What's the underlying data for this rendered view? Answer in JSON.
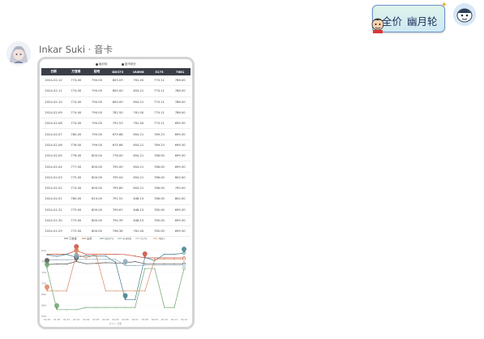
{
  "chip": {
    "part1": "全价",
    "part2": "幽月轮"
  },
  "message": {
    "sender": "Inkar Suki · 音卡"
  },
  "card": {
    "legend_top": [
      "幽月轮",
      "蓝市统计"
    ],
    "table": {
      "headers": [
        "日期",
        "万宝楼",
        "贴吧",
        "DD373",
        "UU898",
        "5173",
        "7881"
      ],
      "rows": [
        [
          "2024-02-12",
          "774.00",
          "790.00",
          "803.03",
          "761.00",
          "770.11",
          "786.00"
        ],
        [
          "2024-02-11",
          "774.00",
          "790.00",
          "800.00",
          "654.21",
          "770.11",
          "786.00"
        ],
        [
          "2024-02-10",
          "774.00",
          "790.00",
          "800.00",
          "654.21",
          "770.11",
          "786.00"
        ],
        [
          "2024-02-09",
          "774.00",
          "790.00",
          "782.50",
          "761.00",
          "770.11",
          "786.00"
        ],
        [
          "2024-02-08",
          "774.00",
          "790.00",
          "791.53",
          "761.00",
          "770.11",
          "699.30"
        ],
        [
          "2024-02-07",
          "780.00",
          "795.00",
          "675.68",
          "654.21",
          "769.23",
          "699.30"
        ],
        [
          "2024-02-06",
          "776.00",
          "799.00",
          "675.68",
          "654.21",
          "769.23",
          "699.30"
        ],
        [
          "2024-02-05",
          "776.00",
          "800.00",
          "778.00",
          "654.21",
          "786.00",
          "699.30"
        ],
        [
          "2024-02-04",
          "777.00",
          "800.00",
          "795.00",
          "654.21",
          "786.00",
          "699.30"
        ],
        [
          "2024-02-03",
          "775.00",
          "800.00",
          "795.04",
          "654.21",
          "786.00",
          "800.00"
        ],
        [
          "2024-02-02",
          "774.00",
          "800.00",
          "795.80",
          "654.21",
          "786.00",
          "790.00"
        ],
        [
          "2024-02-01",
          "780.00",
          "810.00",
          "791.51",
          "648.15",
          "786.00",
          "800.00"
        ],
        [
          "2024-01-31",
          "773.00",
          "800.00",
          "799.67",
          "648.15",
          "785.00",
          "699.30"
        ],
        [
          "2024-01-30",
          "773.00",
          "800.00",
          "794.39",
          "648.15",
          "785.00",
          "699.30"
        ],
        [
          "2024-01-29",
          "772.00",
          "800.00",
          "798.36",
          "761.00",
          "785.00",
          "699.30"
        ]
      ]
    }
  },
  "chart_data": {
    "type": "line",
    "x": [
      "01-29",
      "01-30",
      "01-31",
      "02-01",
      "02-02",
      "02-03",
      "02-04",
      "02-05",
      "02-06",
      "02-07",
      "02-08",
      "02-09",
      "02-10",
      "02-11",
      "02-12"
    ],
    "ylim": [
      630,
      810
    ],
    "yticks": [
      810,
      780,
      750,
      720,
      690,
      660,
      630
    ],
    "xlabel": "Price / 日期",
    "series": [
      {
        "name": "万宝楼",
        "color": "#555555",
        "values": [
          772,
          773,
          773,
          780,
          774,
          775,
          777,
          776,
          776,
          780,
          774,
          774,
          774,
          774,
          774
        ]
      },
      {
        "name": "贴吧",
        "color": "#c84a3a",
        "values": [
          800,
          800,
          800,
          810,
          800,
          800,
          800,
          800,
          799,
          795,
          790,
          790,
          790,
          790,
          790
        ]
      },
      {
        "name": "DD373",
        "color": "#3e7c8c",
        "values": [
          798.36,
          794.39,
          799.67,
          791.51,
          795.8,
          795.04,
          795,
          778,
          675.68,
          675.68,
          791.53,
          782.5,
          800,
          800,
          803.03
        ]
      },
      {
        "name": "UU898",
        "color": "#6ba36f",
        "values": [
          761,
          648.15,
          648.15,
          648.15,
          654.21,
          654.21,
          654.21,
          654.21,
          654.21,
          654.21,
          761,
          761,
          654.21,
          654.21,
          761
        ]
      },
      {
        "name": "5173",
        "color": "#8aa8b8",
        "values": [
          785,
          785,
          785,
          786,
          786,
          786,
          786,
          786,
          769.23,
          769.23,
          770.11,
          770.11,
          770.11,
          770.11,
          770.11
        ]
      },
      {
        "name": "7881",
        "color": "#d9835a",
        "values": [
          699.3,
          699.3,
          699.3,
          800,
          790,
          800,
          699.3,
          699.3,
          699.3,
          699.3,
          699.3,
          786,
          786,
          786,
          786
        ]
      }
    ]
  },
  "colors": {
    "table_header": "#3a3f47",
    "chip_border": "#6a93c8"
  }
}
